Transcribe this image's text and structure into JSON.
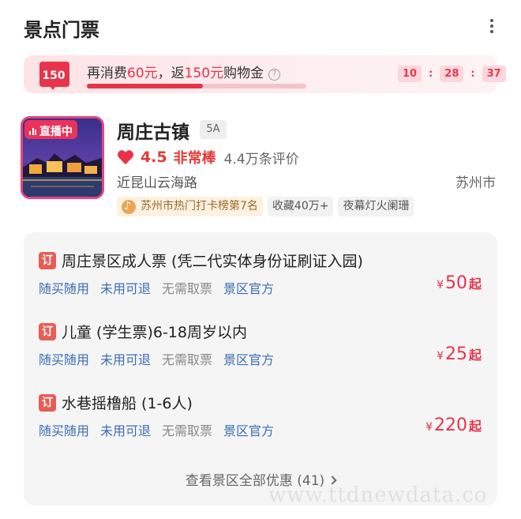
{
  "header": {
    "title": "景点门票",
    "more_icon": "more-vertical-icon"
  },
  "promo": {
    "badge_amount": "150",
    "text_prefix": "再消费",
    "spend_amount": "60元",
    "text_middle": "，返",
    "reward_amount": "150元",
    "text_suffix": "购物金",
    "help_icon": "question-circle-icon",
    "progress_fraction": 0.53,
    "countdown": {
      "hours": "10",
      "minutes": "28",
      "seconds": "37",
      "separator": ":"
    }
  },
  "attraction": {
    "live_badge": "直播中",
    "name": "周庄古镇",
    "level": "5A",
    "rating": "4.5",
    "rating_word": "非常棒",
    "review_count": "4.4万条评价",
    "address": "近昆山云海路",
    "city": "苏州市",
    "tags": [
      "苏州市热门打卡榜第7名",
      "收藏40万+",
      "夜幕灯火阑珊"
    ]
  },
  "tickets": [
    {
      "badge": "订",
      "title": "周庄景区成人票 (凭二代实体身份证刷证入园)",
      "features": [
        "随买随用",
        "未用可退",
        "无需取票",
        "景区官方"
      ],
      "price_symbol": "¥",
      "price": "50",
      "price_suffix": "起"
    },
    {
      "badge": "订",
      "title": "儿童 (学生票)6-18周岁以内",
      "features": [
        "随买随用",
        "未用可退",
        "无需取票",
        "景区官方"
      ],
      "price_symbol": "¥",
      "price": "25",
      "price_suffix": "起"
    },
    {
      "badge": "订",
      "title": "水巷摇橹船 (1-6人)",
      "features": [
        "随买随用",
        "未用可退",
        "无需取票",
        "景区官方"
      ],
      "price_symbol": "¥",
      "price": "220",
      "price_suffix": "起"
    }
  ],
  "view_all": "查看景区全部优惠 (41)",
  "watermark": "www.ttdnewdata.co",
  "colors": {
    "accent_red": "#e8334a",
    "feature_blue": "#3a6db3",
    "live_pink": "#e24680"
  }
}
